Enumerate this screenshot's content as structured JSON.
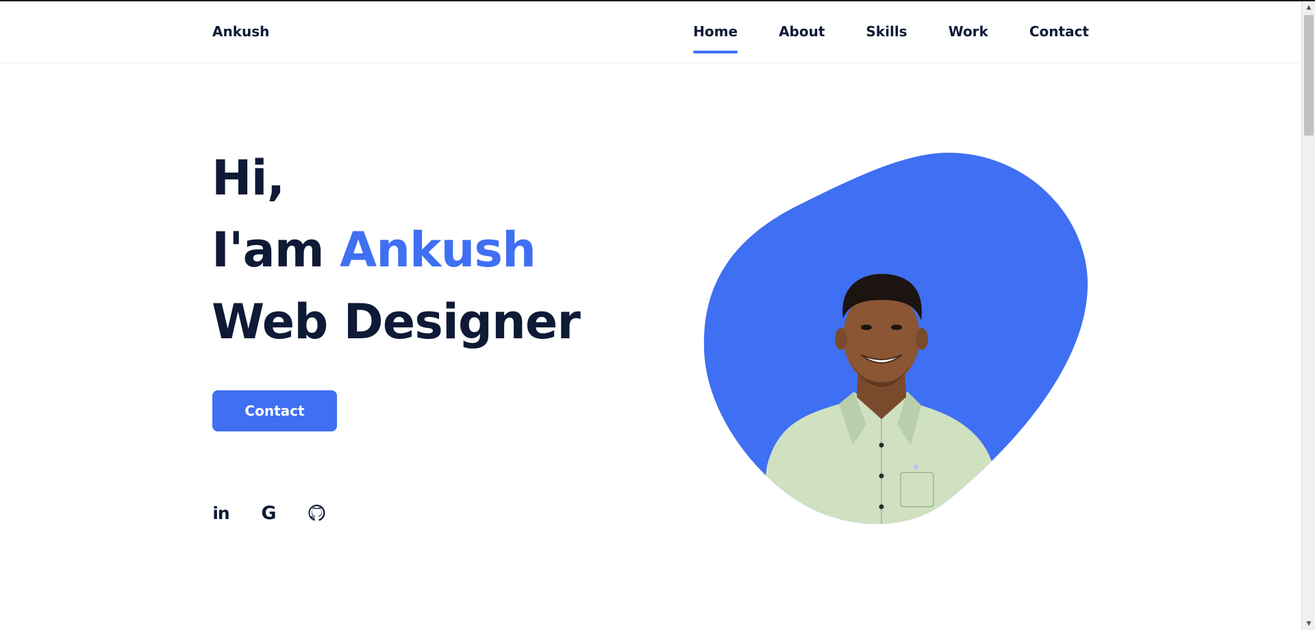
{
  "header": {
    "logo": "Ankush",
    "nav": [
      {
        "label": "Home",
        "active": true
      },
      {
        "label": "About",
        "active": false
      },
      {
        "label": "Skills",
        "active": false
      },
      {
        "label": "Work",
        "active": false
      },
      {
        "label": "Contact",
        "active": false
      }
    ]
  },
  "hero": {
    "greeting": "Hi,",
    "intro_prefix": "I'am",
    "name": "Ankush",
    "role": "Web Designer",
    "cta_label": "Contact"
  },
  "social": {
    "linkedin_glyph": "in",
    "google_glyph": "G",
    "github_icon": "github-icon"
  },
  "colors": {
    "accent": "#3f6ff2",
    "text": "#0e1a36",
    "background": "#ffffff"
  }
}
